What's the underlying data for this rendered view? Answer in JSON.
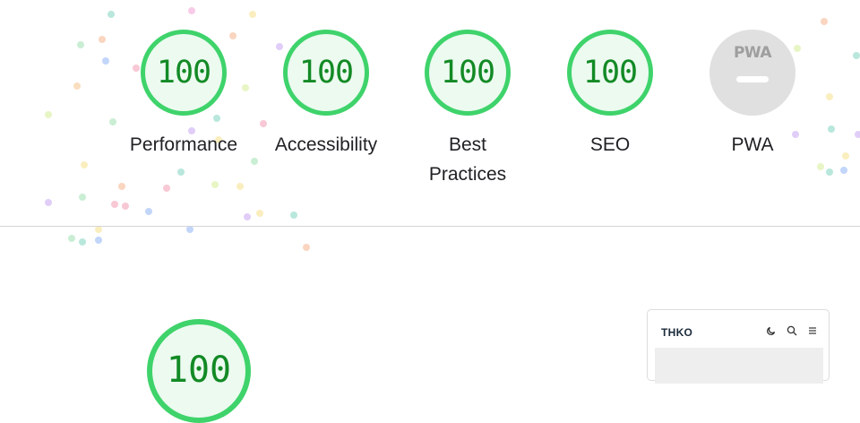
{
  "categories": [
    {
      "score": "100",
      "label": "Performance"
    },
    {
      "score": "100",
      "label": "Accessibility"
    },
    {
      "score": "100",
      "label": "Best Practices"
    },
    {
      "score": "100",
      "label": "SEO"
    },
    {
      "score": "",
      "label": "PWA",
      "badge": "PWA"
    }
  ],
  "colors": {
    "pass_ring": "#3fd36b",
    "pass_fill": "#ecfaf0",
    "pass_text": "#138a25",
    "pwa_fill": "#e0e0e0"
  },
  "detail": {
    "score": "100"
  },
  "thumbnail": {
    "brand": "THKO",
    "icons": [
      "theme-toggle-icon",
      "search-icon",
      "menu-icon"
    ]
  }
}
